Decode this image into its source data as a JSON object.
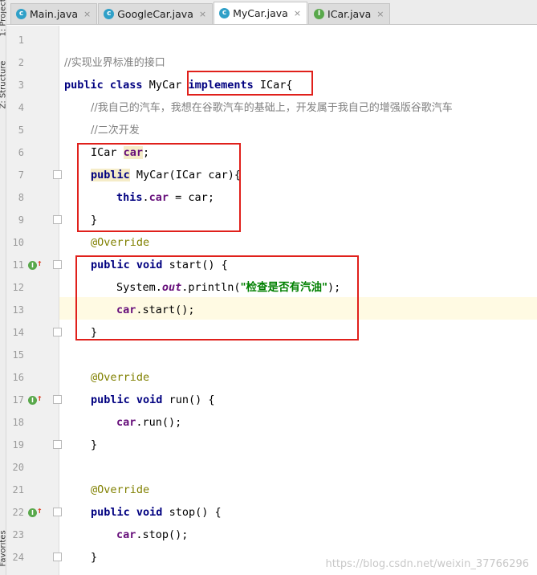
{
  "side_panel": {
    "top_label": "1: Project",
    "mid_label": "Z: Structure",
    "bottom_label": "Favorites"
  },
  "tabs": [
    {
      "label": "Main.java",
      "icon": "class-icon",
      "active": false
    },
    {
      "label": "GoogleCar.java",
      "icon": "class-icon",
      "active": false
    },
    {
      "label": "MyCar.java",
      "icon": "class-icon",
      "active": true
    },
    {
      "label": "ICar.java",
      "icon": "interface-icon",
      "active": false
    }
  ],
  "tab_close_glyph": "×",
  "editor": {
    "line_numbers": [
      "1",
      "2",
      "3",
      "4",
      "5",
      "6",
      "7",
      "8",
      "9",
      "10",
      "11",
      "12",
      "13",
      "14",
      "15",
      "16",
      "17",
      "18",
      "19",
      "20",
      "21",
      "22",
      "23",
      "24"
    ],
    "highlighted_line": "13",
    "code": {
      "l2_comment": "//实现业界标准的接口",
      "l3_public": "public",
      "l3_class": "class",
      "l3_name": "MyCar",
      "l3_implements": "implements",
      "l3_rest": "ICar{",
      "l4_comment": "//我自己的汽车，我想在谷歌汽车的基础上，开发属于我自己的增强版谷歌汽车",
      "l5_comment": "//二次开发",
      "l6_type": "ICar",
      "l6_field": "car",
      "l6_semi": ";",
      "l7_public": "public",
      "l7_rest": "MyCar(ICar car){",
      "l8_this": "this",
      "l8_dot": ".",
      "l8_field": "car",
      "l8_rest": " = car;",
      "l9_brace": "}",
      "l10_ann": "@Override",
      "l11_public": "public",
      "l11_void": "void",
      "l11_rest": "start() {",
      "l12_system": "System.",
      "l12_out": "out",
      "l12_println": ".println(",
      "l12_str": "\"检查是否有汽油\"",
      "l12_end": ");",
      "l13_field": "car",
      "l13_rest": ".start();",
      "l14_brace": "}",
      "l16_ann": "@Override",
      "l17_public": "public",
      "l17_void": "void",
      "l17_rest": "run() {",
      "l18_field": "car",
      "l18_rest": ".run();",
      "l19_brace": "}",
      "l21_ann": "@Override",
      "l22_public": "public",
      "l22_void": "void",
      "l22_rest": "stop() {",
      "l23_field": "car",
      "l23_rest": ".stop();",
      "l24_brace": "}"
    }
  },
  "override_marker": {
    "circle": "I",
    "arrow": "↑"
  },
  "watermark": "https://blog.csdn.net/weixin_37766296",
  "colors": {
    "keyword": "#000080",
    "field": "#660e7a",
    "comment": "#808080",
    "annotation": "#808000",
    "string": "#008000",
    "annotation_box": "#e0201b",
    "current_line": "#fffae3"
  }
}
